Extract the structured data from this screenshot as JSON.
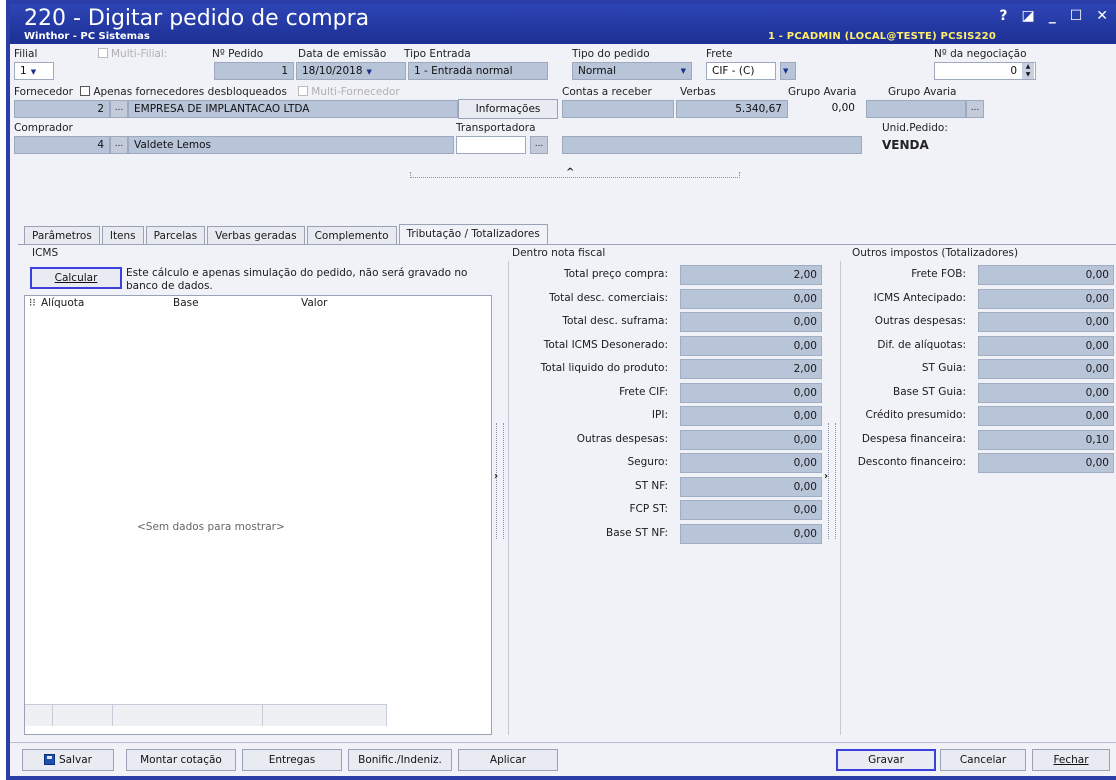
{
  "window": {
    "title": "220 - Digitar pedido de compra",
    "subtitle": "Winthor - PC Sistemas",
    "session": "1 - PCADMIN (LOCAL@TESTE)  PCSIS220",
    "controls": {
      "help": "?",
      "restore": "◪",
      "minimize": "_",
      "maximize": "☐",
      "close": "✕"
    }
  },
  "header": {
    "filial_label": "Filial",
    "filial_value": "1",
    "multi_filial_label": "Multi-Filial:",
    "pedido_label": "Nº Pedido",
    "pedido_value": "1",
    "data_label": "Data de emissão",
    "data_value": "18/10/2018",
    "tipo_entrada_label": "Tipo Entrada",
    "tipo_entrada_value": "1 - Entrada normal",
    "tipo_pedido_label": "Tipo do pedido",
    "tipo_pedido_value": "Normal",
    "frete_label": "Frete",
    "frete_value": "CIF - (C)",
    "negociacao_label": "Nº da negociação",
    "negociacao_value": "0",
    "fornecedor_label": "Fornecedor",
    "apenas_desbloqueados_label": "Apenas fornecedores desbloqueados",
    "multi_fornecedor_label": "Multi-Fornecedor",
    "fornecedor_code": "2",
    "fornecedor_name": "EMPRESA DE IMPLANTACAO LTDA",
    "informacoes_label": "Informações",
    "contas_receber_label": "Contas a receber",
    "verbas_label": "Verbas",
    "verbas_value": "5.340,67",
    "grupo_avaria_label": "Grupo Avaria",
    "grupo_avaria_value": "0,00",
    "grupo_avaria2_label": "Grupo Avaria",
    "comprador_label": "Comprador",
    "comprador_code": "4",
    "comprador_name": "Valdete Lemos",
    "transportadora_label": "Transportadora",
    "unid_pedido_label": "Unid.Pedido:",
    "unid_pedido_value": "VENDA",
    "ellipsis": "..."
  },
  "tabs": [
    {
      "label": "Parâmetros"
    },
    {
      "label": "Itens"
    },
    {
      "label": "Parcelas"
    },
    {
      "label": "Verbas geradas"
    },
    {
      "label": "Complemento"
    },
    {
      "label": "Tributação / Totalizadores"
    }
  ],
  "icms": {
    "title": "ICMS",
    "calcular_label": "Calcular",
    "note": "Este cálculo e apenas  simulação do pedido, não será gravado no banco de dados.",
    "columns": [
      "Alíquota",
      "Base",
      "Valor"
    ],
    "empty": "<Sem dados para mostrar>"
  },
  "dentro_nota": {
    "title": "Dentro nota fiscal",
    "rows": [
      {
        "label": "Total preço compra:",
        "value": "2,00"
      },
      {
        "label": "Total desc. comerciais:",
        "value": "0,00"
      },
      {
        "label": "Total desc. suframa:",
        "value": "0,00"
      },
      {
        "label": "Total ICMS Desonerado:",
        "value": "0,00"
      },
      {
        "label": "Total liquido do produto:",
        "value": "2,00"
      },
      {
        "label": "Frete CIF:",
        "value": "0,00"
      },
      {
        "label": "IPI:",
        "value": "0,00"
      },
      {
        "label": "Outras despesas:",
        "value": "0,00"
      },
      {
        "label": "Seguro:",
        "value": "0,00"
      },
      {
        "label": "ST NF:",
        "value": "0,00"
      },
      {
        "label": "FCP ST:",
        "value": "0,00"
      },
      {
        "label": "Base ST NF:",
        "value": "0,00"
      }
    ]
  },
  "outros": {
    "title": "Outros impostos (Totalizadores)",
    "rows": [
      {
        "label": "Frete FOB:",
        "value": "0,00"
      },
      {
        "label": "ICMS Antecipado:",
        "value": "0,00"
      },
      {
        "label": "Outras despesas:",
        "value": "0,00"
      },
      {
        "label": "Dif. de alíquotas:",
        "value": "0,00"
      },
      {
        "label": "ST Guia:",
        "value": "0,00"
      },
      {
        "label": "Base ST Guia:",
        "value": "0,00"
      },
      {
        "label": "Crédito presumido:",
        "value": "0,00"
      },
      {
        "label": "Despesa financeira:",
        "value": "0,10"
      },
      {
        "label": "Desconto financeiro:",
        "value": "0,00"
      }
    ]
  },
  "footer": {
    "salvar": "Salvar",
    "montar_cotacao": "Montar cotação",
    "entregas": "Entregas",
    "bonific": "Bonific./Indeniz.",
    "aplicar": "Aplicar",
    "gravar": "Gravar",
    "cancelar": "Cancelar",
    "fechar": "Fechar"
  }
}
